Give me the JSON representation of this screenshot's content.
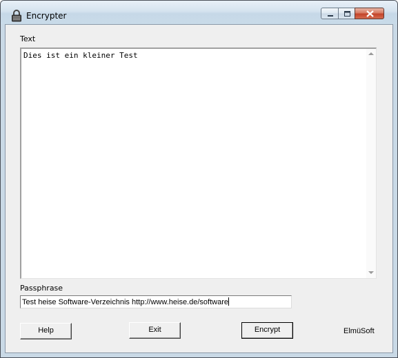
{
  "window": {
    "title": "Encrypter"
  },
  "text_label": "Text",
  "text_content": "Dies ist ein kleiner Test",
  "passphrase_label": "Passphrase",
  "passphrase_value": "Test heise Software-Verzeichnis http://www.heise.de/software",
  "buttons": {
    "help": "Help",
    "exit": "Exit",
    "encrypt": "Encrypt"
  },
  "brand": "ElmüSoft",
  "icons": {
    "app": "padlock-icon",
    "minimize": "minimize-icon",
    "maximize": "maximize-icon",
    "close": "close-icon",
    "scroll_up": "scroll-up-arrow-icon",
    "scroll_down": "scroll-down-arrow-icon"
  },
  "colors": {
    "close_button": "#c4442a",
    "titlebar": "#d5e3ef",
    "client_bg": "#efefef"
  }
}
